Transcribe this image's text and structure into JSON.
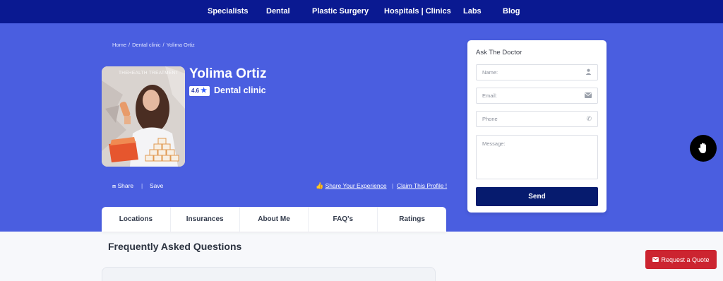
{
  "nav": {
    "items": [
      {
        "label": "Specialists"
      },
      {
        "label": "Dental"
      },
      {
        "label": "Plastic Surgery"
      },
      {
        "label": "Hospitals | Clinics"
      },
      {
        "label": "Labs"
      },
      {
        "label": "Blog"
      }
    ]
  },
  "breadcrumb": {
    "items": [
      "Home",
      "Dental clinic",
      "Yolima Ortiz"
    ],
    "separator": "/"
  },
  "profile": {
    "photo_watermark": "THEHEALTH TREATMENT",
    "name": "Yolima Ortiz",
    "rating": "4.6",
    "specialty": "Dental clinic",
    "share_label": "Share",
    "save_label": "Save",
    "share_experience_label": "Share Your Experience",
    "action_separator": "|",
    "claim_label": "Claim This Profile !"
  },
  "tabs": [
    {
      "label": "Locations"
    },
    {
      "label": "Insurances"
    },
    {
      "label": "About Me"
    },
    {
      "label": "FAQ's"
    },
    {
      "label": "Ratings"
    }
  ],
  "faq": {
    "title": "Frequently Asked Questions"
  },
  "ask": {
    "title": "Ask The Doctor",
    "name_placeholder": "Name:",
    "email_placeholder": "Email:",
    "phone_placeholder": "Phone",
    "message_placeholder": "Message:",
    "send_label": "Send"
  },
  "quote": {
    "label": "Request a Quote"
  },
  "colors": {
    "nav_bg": "#0a1991",
    "hero_bg": "#4a5ee0",
    "send_bg": "#061b6e",
    "quote_bg": "#cc2430"
  }
}
